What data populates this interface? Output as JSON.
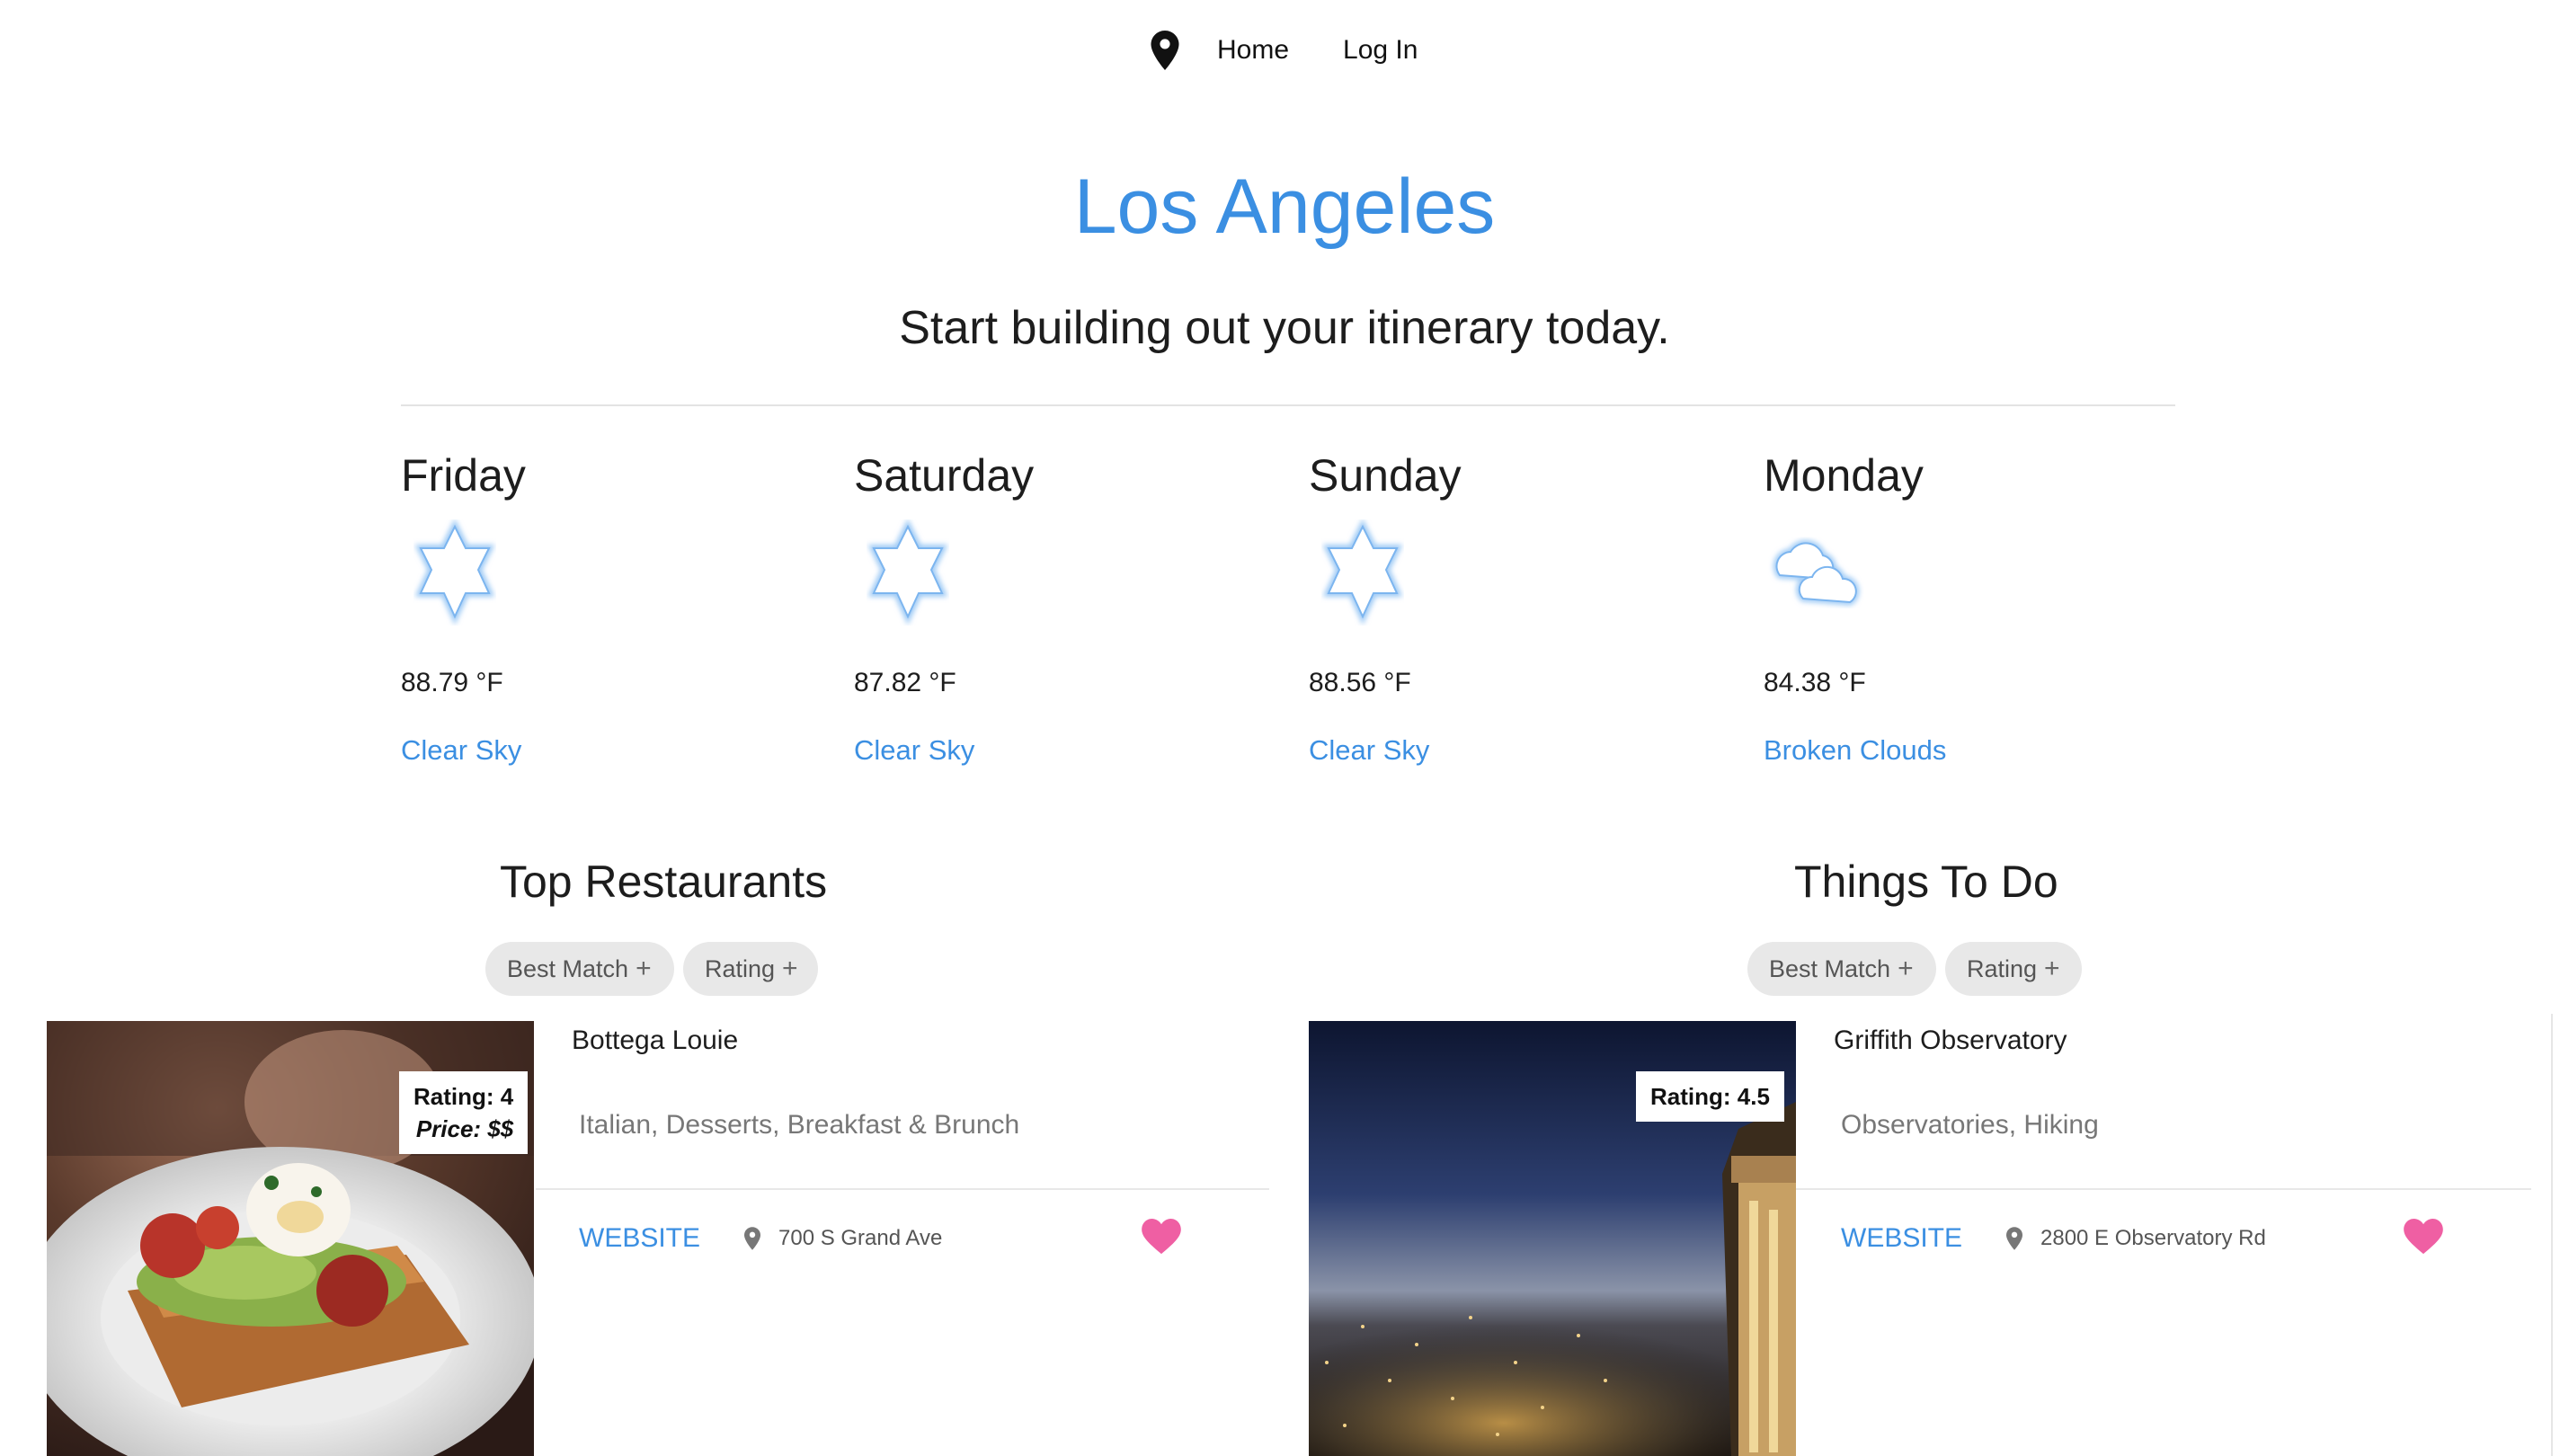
{
  "nav": {
    "icon": "location-pin-icon",
    "home": "Home",
    "login": "Log In"
  },
  "header": {
    "title": "Los Angeles",
    "subtitle": "Start building out your itinerary today."
  },
  "forecast": [
    {
      "day": "Friday",
      "icon": "clear-sky-icon",
      "temp": "88.79 °F",
      "desc": "Clear Sky"
    },
    {
      "day": "Saturday",
      "icon": "clear-sky-icon",
      "temp": "87.82 °F",
      "desc": "Clear Sky"
    },
    {
      "day": "Sunday",
      "icon": "clear-sky-icon",
      "temp": "88.56 °F",
      "desc": "Clear Sky"
    },
    {
      "day": "Monday",
      "icon": "broken-clouds-icon",
      "temp": "84.38 °F",
      "desc": "Broken Clouds"
    }
  ],
  "restaurants": {
    "heading": "Top Restaurants",
    "sort_best": "Best Match",
    "sort_rating": "Rating",
    "plus": "+",
    "card": {
      "name": "Bottega Louie",
      "rating": "Rating: 4",
      "price": "Price: $$",
      "categories": "Italian, Desserts, Breakfast & Brunch",
      "website": "WEBSITE",
      "address": "700 S Grand Ave"
    }
  },
  "things": {
    "heading": "Things To Do",
    "sort_best": "Best Match",
    "sort_rating": "Rating",
    "plus": "+",
    "card": {
      "name": "Griffith Observatory",
      "rating": "Rating: 4.5",
      "categories": "Observatories, Hiking",
      "website": "WEBSITE",
      "address": "2800 E Observatory Rd"
    }
  },
  "colors": {
    "accent": "#3b8fe2",
    "heart": "#ef5fa3",
    "pill": "#e8e8e8"
  }
}
